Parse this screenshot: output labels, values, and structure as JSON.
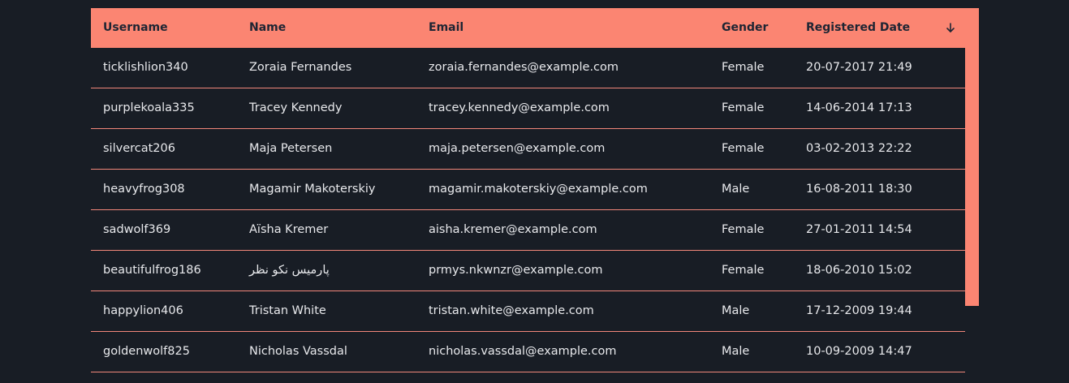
{
  "table": {
    "columns": [
      {
        "label": "Username"
      },
      {
        "label": "Name"
      },
      {
        "label": "Email"
      },
      {
        "label": "Gender"
      },
      {
        "label": "Registered Date"
      }
    ],
    "sort_indicator": "arrow-down-icon",
    "rows": [
      {
        "username": "ticklishlion340",
        "name": "Zoraia Fernandes",
        "email": "zoraia.fernandes@example.com",
        "gender": "Female",
        "registered": "20-07-2017 21:49"
      },
      {
        "username": "purplekoala335",
        "name": "Tracey Kennedy",
        "email": "tracey.kennedy@example.com",
        "gender": "Female",
        "registered": "14-06-2014 17:13"
      },
      {
        "username": "silvercat206",
        "name": "Maja Petersen",
        "email": "maja.petersen@example.com",
        "gender": "Female",
        "registered": "03-02-2013 22:22"
      },
      {
        "username": "heavyfrog308",
        "name": "Magamir Makoterskiy",
        "email": "magamir.makoterskiy@example.com",
        "gender": "Male",
        "registered": "16-08-2011 18:30"
      },
      {
        "username": "sadwolf369",
        "name": "Aïsha Kremer",
        "email": "aisha.kremer@example.com",
        "gender": "Female",
        "registered": "27-01-2011 14:54"
      },
      {
        "username": "beautifulfrog186",
        "name": "پارمیس نکو نظر",
        "email": "prmys.nkwnzr@example.com",
        "gender": "Female",
        "registered": "18-06-2010 15:02"
      },
      {
        "username": "happylion406",
        "name": "Tristan White",
        "email": "tristan.white@example.com",
        "gender": "Male",
        "registered": "17-12-2009 19:44"
      },
      {
        "username": "goldenwolf825",
        "name": "Nicholas Vassdal",
        "email": "nicholas.vassdal@example.com",
        "gender": "Male",
        "registered": "10-09-2009 14:47"
      }
    ]
  },
  "colors": {
    "background": "#181d25",
    "header": "#fb8572",
    "header_text": "#1e2533",
    "row_text": "#e8e9ec",
    "row_divider": "#f2877a"
  }
}
